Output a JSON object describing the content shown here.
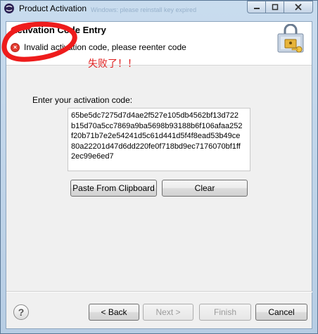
{
  "window": {
    "title": "Product Activation",
    "title_background_text": "Windows: please reinstall key expired",
    "app_icon": "eclipse-logo-icon",
    "controls": [
      "minimize-icon",
      "maximize-icon",
      "close-icon"
    ]
  },
  "header": {
    "title": "Activation Code Entry",
    "error_icon": "error-x-icon",
    "error_message": "Invalid activation code, please reenter code",
    "banner_icon": "lock-with-key-icon"
  },
  "annotation": {
    "text": "失败了！！",
    "color": "#e02020"
  },
  "form": {
    "prompt": "Enter your activation code:",
    "code_lines": [
      "65be5dc7275d7d4ae2f527e105db4562bf13d722",
      "b15d70a5cc7869a9ba5698b93188b6f106afaa252",
      "f20b71b7e2e54241d5c61d441d5f4f8ead53b49ce",
      "80a22201d47d6dd220fe0f718bd9ec7176070bf1ff",
      "2ec99e6ed7"
    ],
    "paste_label": "Paste From Clipboard",
    "clear_label": "Clear"
  },
  "footer": {
    "help_glyph": "?",
    "back_label": "< Back",
    "next_label": "Next >",
    "finish_label": "Finish",
    "cancel_label": "Cancel"
  },
  "colors": {
    "accent_frame": "#b7cde4",
    "error_red": "#e23a2e"
  }
}
